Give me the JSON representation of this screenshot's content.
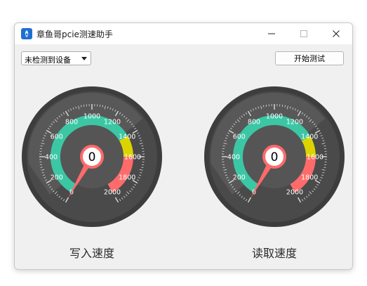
{
  "window": {
    "title": "章鱼哥pcie测速助手"
  },
  "toolbar": {
    "device_combo_value": "未检测到设备",
    "start_button_label": "开始测试"
  },
  "gauges": [
    {
      "id": "write",
      "label": "写入速度",
      "value": 0,
      "value_text": "0",
      "min": 0,
      "max": 2000,
      "tick_labels": [
        "0",
        "200",
        "400",
        "600",
        "800",
        "1000",
        "1200",
        "1400",
        "1600",
        "1800",
        "2000"
      ],
      "zones": [
        {
          "from": 0,
          "to": 1400,
          "color": "#3cc7a4"
        },
        {
          "from": 1400,
          "to": 1600,
          "color": "#dcd400"
        },
        {
          "from": 1600,
          "to": 2000,
          "color": "#ff6b6b"
        }
      ]
    },
    {
      "id": "read",
      "label": "读取速度",
      "value": 0,
      "value_text": "0",
      "min": 0,
      "max": 2000,
      "tick_labels": [
        "0",
        "200",
        "400",
        "600",
        "800",
        "1000",
        "1200",
        "1400",
        "1600",
        "1800",
        "2000"
      ],
      "zones": [
        {
          "from": 0,
          "to": 1400,
          "color": "#3cc7a4"
        },
        {
          "from": 1400,
          "to": 1600,
          "color": "#dcd400"
        },
        {
          "from": 1600,
          "to": 2000,
          "color": "#ff6b6b"
        }
      ]
    }
  ],
  "colors": {
    "needle": "#ff6b6b",
    "bezel": "#3d3d3d",
    "dial": "#555555"
  }
}
